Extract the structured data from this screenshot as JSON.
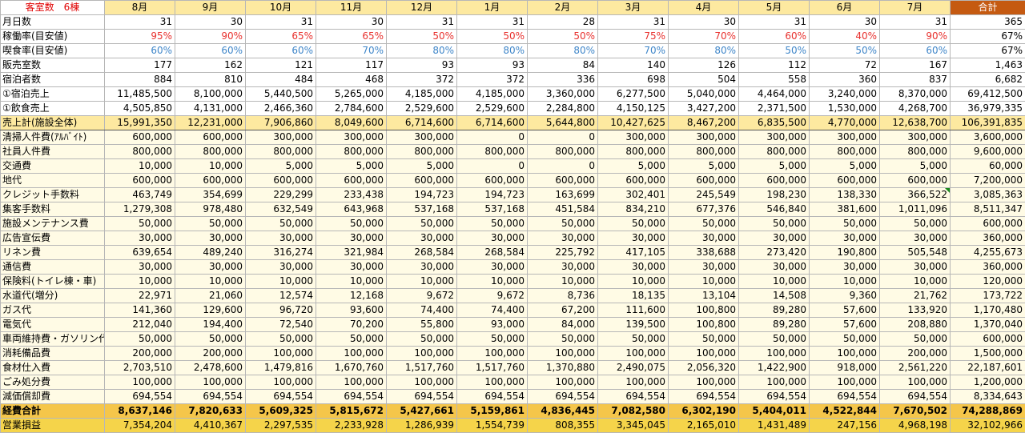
{
  "sheet": {
    "corner_label": "客室数　6棟",
    "months": [
      "8月",
      "9月",
      "10月",
      "11月",
      "12月",
      "1月",
      "2月",
      "3月",
      "4月",
      "5月",
      "6月",
      "7月"
    ],
    "total_label": "合計",
    "rows": [
      {
        "label": "月日数",
        "values": [
          "31",
          "30",
          "31",
          "30",
          "31",
          "31",
          "28",
          "31",
          "30",
          "31",
          "30",
          "31"
        ],
        "total": "365",
        "style": "plain"
      },
      {
        "label": "稼働率(目安値)",
        "values": [
          "95%",
          "90%",
          "65%",
          "65%",
          "50%",
          "50%",
          "50%",
          "75%",
          "70%",
          "60%",
          "40%",
          "90%"
        ],
        "total": "67%",
        "style": "rate-red"
      },
      {
        "label": "喫食率(目安値)",
        "values": [
          "60%",
          "60%",
          "60%",
          "70%",
          "80%",
          "80%",
          "80%",
          "70%",
          "80%",
          "50%",
          "50%",
          "60%"
        ],
        "total": "67%",
        "style": "rate-blue"
      },
      {
        "label": "販売室数",
        "values": [
          "177",
          "162",
          "121",
          "117",
          "93",
          "93",
          "84",
          "140",
          "126",
          "112",
          "72",
          "167"
        ],
        "total": "1,463",
        "style": "plain"
      },
      {
        "label": "宿泊者数",
        "values": [
          "884",
          "810",
          "484",
          "468",
          "372",
          "372",
          "336",
          "698",
          "504",
          "558",
          "360",
          "837"
        ],
        "total": "6,682",
        "style": "plain"
      },
      {
        "label": "①宿泊売上",
        "values": [
          "11,485,500",
          "8,100,000",
          "5,440,500",
          "5,265,000",
          "4,185,000",
          "4,185,000",
          "3,360,000",
          "6,277,500",
          "5,040,000",
          "4,464,000",
          "3,240,000",
          "8,370,000"
        ],
        "total": "69,412,500",
        "style": "plain"
      },
      {
        "label": "①飲食売上",
        "values": [
          "4,505,850",
          "4,131,000",
          "2,466,360",
          "2,784,600",
          "2,529,600",
          "2,529,600",
          "2,284,800",
          "4,150,125",
          "3,427,200",
          "2,371,500",
          "1,530,000",
          "4,268,700"
        ],
        "total": "36,979,335",
        "style": "plain"
      },
      {
        "label": "売上計(施設全体)",
        "values": [
          "15,991,350",
          "12,231,000",
          "7,906,860",
          "8,049,600",
          "6,714,600",
          "6,714,600",
          "5,644,800",
          "10,427,625",
          "8,467,200",
          "6,835,500",
          "4,770,000",
          "12,638,700"
        ],
        "total": "106,391,835",
        "style": "total-row"
      },
      {
        "label": "清掃人件費(ｱﾙﾊﾞｲﾄ)",
        "values": [
          "600,000",
          "600,000",
          "300,000",
          "300,000",
          "300,000",
          "0",
          "0",
          "300,000",
          "300,000",
          "300,000",
          "300,000",
          "300,000"
        ],
        "total": "3,600,000",
        "style": "cream"
      },
      {
        "label": "社員人件費",
        "values": [
          "800,000",
          "800,000",
          "800,000",
          "800,000",
          "800,000",
          "800,000",
          "800,000",
          "800,000",
          "800,000",
          "800,000",
          "800,000",
          "800,000"
        ],
        "total": "9,600,000",
        "style": "cream"
      },
      {
        "label": "交通費",
        "values": [
          "10,000",
          "10,000",
          "5,000",
          "5,000",
          "5,000",
          "0",
          "0",
          "5,000",
          "5,000",
          "5,000",
          "5,000",
          "5,000"
        ],
        "total": "60,000",
        "style": "cream"
      },
      {
        "label": "地代",
        "values": [
          "600,000",
          "600,000",
          "600,000",
          "600,000",
          "600,000",
          "600,000",
          "600,000",
          "600,000",
          "600,000",
          "600,000",
          "600,000",
          "600,000"
        ],
        "total": "7,200,000",
        "style": "cream"
      },
      {
        "label": "クレジット手数料",
        "values": [
          "463,749",
          "354,699",
          "229,299",
          "233,438",
          "194,723",
          "194,723",
          "163,699",
          "302,401",
          "245,549",
          "198,230",
          "138,330",
          "366,522"
        ],
        "total": "3,085,363",
        "style": "cream"
      },
      {
        "label": "集客手数料",
        "values": [
          "1,279,308",
          "978,480",
          "632,549",
          "643,968",
          "537,168",
          "537,168",
          "451,584",
          "834,210",
          "677,376",
          "546,840",
          "381,600",
          "1,011,096"
        ],
        "total": "8,511,347",
        "style": "cream"
      },
      {
        "label": "施設メンテナンス費",
        "values": [
          "50,000",
          "50,000",
          "50,000",
          "50,000",
          "50,000",
          "50,000",
          "50,000",
          "50,000",
          "50,000",
          "50,000",
          "50,000",
          "50,000"
        ],
        "total": "600,000",
        "style": "cream"
      },
      {
        "label": "広告宣伝費",
        "values": [
          "30,000",
          "30,000",
          "30,000",
          "30,000",
          "30,000",
          "30,000",
          "30,000",
          "30,000",
          "30,000",
          "30,000",
          "30,000",
          "30,000"
        ],
        "total": "360,000",
        "style": "cream"
      },
      {
        "label": "リネン費",
        "values": [
          "639,654",
          "489,240",
          "316,274",
          "321,984",
          "268,584",
          "268,584",
          "225,792",
          "417,105",
          "338,688",
          "273,420",
          "190,800",
          "505,548"
        ],
        "total": "4,255,673",
        "style": "cream"
      },
      {
        "label": "通信費",
        "values": [
          "30,000",
          "30,000",
          "30,000",
          "30,000",
          "30,000",
          "30,000",
          "30,000",
          "30,000",
          "30,000",
          "30,000",
          "30,000",
          "30,000"
        ],
        "total": "360,000",
        "style": "cream"
      },
      {
        "label": "保険料(トイレ棟・車)",
        "values": [
          "10,000",
          "10,000",
          "10,000",
          "10,000",
          "10,000",
          "10,000",
          "10,000",
          "10,000",
          "10,000",
          "10,000",
          "10,000",
          "10,000"
        ],
        "total": "120,000",
        "style": "cream"
      },
      {
        "label": "水道代(増分)",
        "values": [
          "22,971",
          "21,060",
          "12,574",
          "12,168",
          "9,672",
          "9,672",
          "8,736",
          "18,135",
          "13,104",
          "14,508",
          "9,360",
          "21,762"
        ],
        "total": "173,722",
        "style": "cream"
      },
      {
        "label": "ガス代",
        "values": [
          "141,360",
          "129,600",
          "96,720",
          "93,600",
          "74,400",
          "74,400",
          "67,200",
          "111,600",
          "100,800",
          "89,280",
          "57,600",
          "133,920"
        ],
        "total": "1,170,480",
        "style": "cream"
      },
      {
        "label": "電気代",
        "values": [
          "212,040",
          "194,400",
          "72,540",
          "70,200",
          "55,800",
          "93,000",
          "84,000",
          "139,500",
          "100,800",
          "89,280",
          "57,600",
          "208,880"
        ],
        "total": "1,370,040",
        "style": "cream"
      },
      {
        "label": "車両維持費・ガソリン代",
        "values": [
          "50,000",
          "50,000",
          "50,000",
          "50,000",
          "50,000",
          "50,000",
          "50,000",
          "50,000",
          "50,000",
          "50,000",
          "50,000",
          "50,000"
        ],
        "total": "600,000",
        "style": "cream"
      },
      {
        "label": "消耗備品費",
        "values": [
          "200,000",
          "200,000",
          "100,000",
          "100,000",
          "100,000",
          "100,000",
          "100,000",
          "100,000",
          "100,000",
          "100,000",
          "100,000",
          "200,000"
        ],
        "total": "1,500,000",
        "style": "cream"
      },
      {
        "label": "食材仕入費",
        "values": [
          "2,703,510",
          "2,478,600",
          "1,479,816",
          "1,670,760",
          "1,517,760",
          "1,517,760",
          "1,370,880",
          "2,490,075",
          "2,056,320",
          "1,422,900",
          "918,000",
          "2,561,220"
        ],
        "total": "22,187,601",
        "style": "cream"
      },
      {
        "label": "ごみ処分費",
        "values": [
          "100,000",
          "100,000",
          "100,000",
          "100,000",
          "100,000",
          "100,000",
          "100,000",
          "100,000",
          "100,000",
          "100,000",
          "100,000",
          "100,000"
        ],
        "total": "1,200,000",
        "style": "cream"
      },
      {
        "label": "減価償却費",
        "values": [
          "694,554",
          "694,554",
          "694,554",
          "694,554",
          "694,554",
          "694,554",
          "694,554",
          "694,554",
          "694,554",
          "694,554",
          "694,554",
          "694,554"
        ],
        "total": "8,334,643",
        "style": "cream"
      },
      {
        "label": "経費合計",
        "values": [
          "8,637,146",
          "7,820,633",
          "5,609,325",
          "5,815,672",
          "5,427,661",
          "5,159,861",
          "4,836,445",
          "7,082,580",
          "6,302,190",
          "5,404,011",
          "4,522,844",
          "7,670,502"
        ],
        "total": "74,288,869",
        "style": "exp-total"
      },
      {
        "label": "営業損益",
        "values": [
          "7,354,204",
          "4,410,367",
          "2,297,535",
          "2,233,928",
          "1,286,939",
          "1,554,739",
          "808,355",
          "3,345,045",
          "2,165,010",
          "1,431,489",
          "247,156",
          "4,968,198"
        ],
        "total": "32,102,966",
        "style": "op-total"
      }
    ]
  }
}
